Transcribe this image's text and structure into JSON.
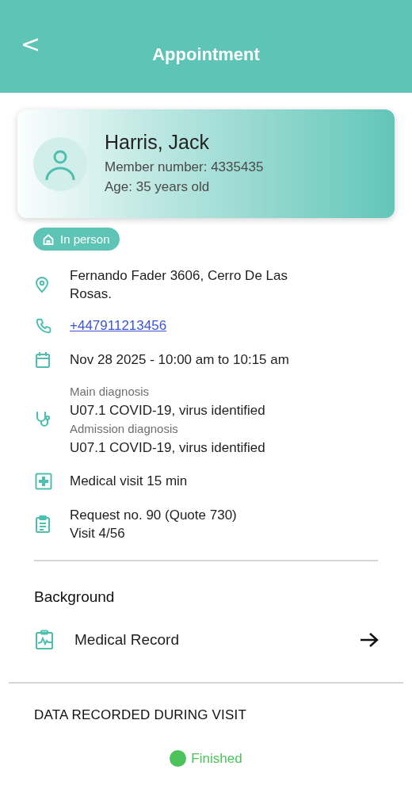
{
  "header": {
    "back": "<",
    "title": "Appointment"
  },
  "patient": {
    "name": "Harris, Jack",
    "member": "Member number: 4335435",
    "age": "Age: 35 years old"
  },
  "modality": "In person",
  "details": [
    {
      "kind": "address",
      "lines": [
        "Fernando Fader 3606, Cerro De Las Rosas."
      ]
    },
    {
      "kind": "phone",
      "link": "+447911213456"
    },
    {
      "kind": "date",
      "lines": [
        "Nov 28 2025 - 10:00 am to 10:15 am"
      ]
    },
    {
      "kind": "diagnosis",
      "entries": [
        {
          "label": "Main diagnosis",
          "value": "U07.1 COVID-19, virus identified"
        },
        {
          "label": "Admission diagnosis",
          "value": "U07.1 COVID-19, virus identified"
        }
      ]
    },
    {
      "kind": "duration",
      "lines": [
        "Medical visit 15 min"
      ]
    },
    {
      "kind": "request",
      "lines": [
        "Request no. 90 (Quote 730)",
        "Visit 4/56"
      ]
    }
  ],
  "background": {
    "heading": "Background",
    "item": "Medical Record"
  },
  "recorded": {
    "heading": "DATA RECORDED DURING VISIT",
    "status": {
      "label": "Finished",
      "color": "#4cc35a"
    }
  }
}
